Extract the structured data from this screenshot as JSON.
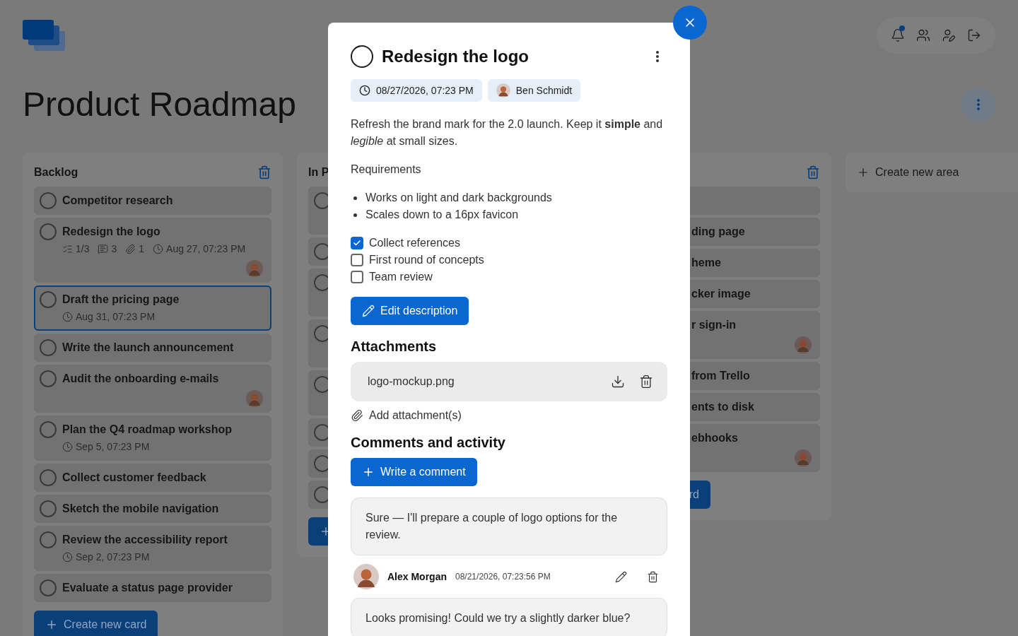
{
  "app": {
    "title": "Product Roadmap"
  },
  "notifications": {
    "unread": true
  },
  "columns": [
    {
      "title": "Backlog",
      "button": "Create new card",
      "cards": [
        {
          "title": "Competitor research",
          "completed": false,
          "selected": false,
          "avatar": false
        },
        {
          "title": "Redesign the logo",
          "completed": false,
          "selected": false,
          "avatar": true,
          "badges": [
            {
              "kind": "checklist",
              "text": "1/3"
            },
            {
              "kind": "comments",
              "text": "3"
            },
            {
              "kind": "attachments",
              "text": "1"
            },
            {
              "kind": "due",
              "text": "Aug 27, 07:23 PM"
            }
          ]
        },
        {
          "title": "Draft the pricing page",
          "completed": false,
          "selected": true,
          "avatar": false,
          "badges": [
            {
              "kind": "due",
              "text": "Aug 31, 07:23 PM"
            }
          ]
        },
        {
          "title": "Write the launch announcement",
          "completed": false,
          "selected": false,
          "avatar": false
        },
        {
          "title": "Audit the onboarding e-mails",
          "completed": false,
          "selected": false,
          "avatar": true
        },
        {
          "title": "Plan the Q4 roadmap workshop",
          "completed": false,
          "selected": false,
          "avatar": false,
          "badges": [
            {
              "kind": "due",
              "text": "Sep 5, 07:23 PM"
            }
          ]
        },
        {
          "title": "Collect customer feedback",
          "completed": false,
          "selected": false,
          "avatar": false
        },
        {
          "title": "Sketch the mobile navigation",
          "completed": false,
          "selected": false,
          "avatar": false
        },
        {
          "title": "Review the accessibility report",
          "completed": false,
          "selected": false,
          "avatar": false,
          "badges": [
            {
              "kind": "due",
              "text": "Sep 2, 07:23 PM"
            }
          ]
        },
        {
          "title": "Evaluate a status page provider",
          "completed": false,
          "selected": false,
          "avatar": false
        }
      ]
    },
    {
      "title": "In P",
      "cards": [
        {
          "completed": false
        },
        {
          "completed": false
        },
        {
          "completed": false
        },
        {
          "completed": false
        },
        {
          "completed": false
        },
        {
          "completed": false
        },
        {
          "completed": false
        },
        {
          "completed": false
        }
      ]
    },
    {
      "button": "rd",
      "cards": [
        {
          "avatar": false
        },
        {
          "title": "ding page",
          "avatar": false
        },
        {
          "title": "heme",
          "avatar": false
        },
        {
          "title": "cker image",
          "avatar": false
        },
        {
          "title": "r sign-in",
          "avatar": true
        },
        {
          "title": "from Trello",
          "avatar": false
        },
        {
          "title": "ents to disk",
          "avatar": false
        },
        {
          "title": "ebhooks",
          "avatar": true
        }
      ]
    }
  ],
  "create_area": "Create new area",
  "card_modal": {
    "title": "Redesign the logo",
    "completed": false,
    "due": "08/27/2026, 07:23 PM",
    "assignee": "Ben Schmidt",
    "description": "Refresh the brand mark for the 2.0 launch. Keep it **simple** and *legible* at small sizes.",
    "subheading": "Requirements",
    "bullets": [
      "Works on light and dark backgrounds",
      "Scales down to a 16px favicon"
    ],
    "checklist": [
      {
        "label": "Collect references",
        "checked": true
      },
      {
        "label": "First round of concepts",
        "checked": false
      },
      {
        "label": "Team review",
        "checked": false
      }
    ],
    "edit_button": "Edit description",
    "attachments_title": "Attachments",
    "attachments": [
      {
        "name": "logo-mockup.png"
      }
    ],
    "add_attachment": "Add attachment(s)",
    "comments_title": "Comments and activity",
    "comment_button": "Write a comment",
    "comments": [
      {
        "text": "Sure — I'll prepare a couple of logo options for the review.",
        "author": "Alex Morgan",
        "time": "08/21/2026, 07:23:56 PM"
      },
      {
        "text": "Looks promising! Could we try a slightly darker blue?"
      }
    ]
  }
}
